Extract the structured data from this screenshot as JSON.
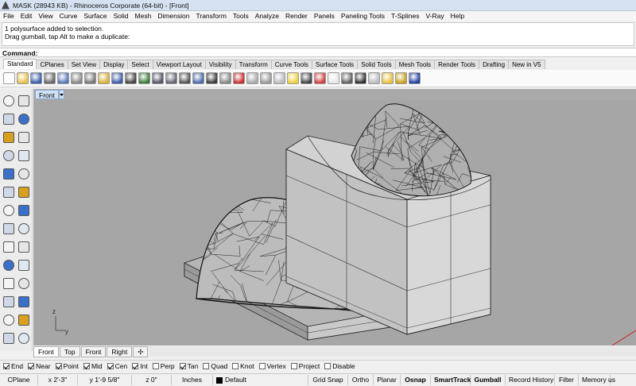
{
  "window": {
    "title": "MASK (28943 KB) - Rhinoceros Corporate (64-bit) - [Front]"
  },
  "menu": [
    "File",
    "Edit",
    "View",
    "Curve",
    "Surface",
    "Solid",
    "Mesh",
    "Dimension",
    "Transform",
    "Tools",
    "Analyze",
    "Render",
    "Panels",
    "Paneling Tools",
    "T-Splines",
    "V-Ray",
    "Help"
  ],
  "history": {
    "line1": "1 polysurface added to selection.",
    "line2": "Drag gumball, tap Alt to make a duplicate:"
  },
  "command": {
    "label": "Command:"
  },
  "toolbar_tabs": [
    "Standard",
    "CPlanes",
    "Set View",
    "Display",
    "Select",
    "Viewport Layout",
    "Visibility",
    "Transform",
    "Curve Tools",
    "Surface Tools",
    "Solid Tools",
    "Mesh Tools",
    "Render Tools",
    "Drafting",
    "New in V5"
  ],
  "toolbar_icons": [
    "new-file-icon",
    "open-folder-icon",
    "save-icon",
    "print-icon",
    "import-icon",
    "cut-icon",
    "copy-icon",
    "paste-icon",
    "undo-icon",
    "pan-hand-icon",
    "rotate-view-icon",
    "zoom-icon",
    "zoom-window-icon",
    "zoom-extents-icon",
    "zoom-selected-icon",
    "set-view-icon",
    "four-viewports-icon",
    "car-icon",
    "light-icon",
    "sphere-shade-icon",
    "target-icon",
    "bulb-icon",
    "lock-icon",
    "material-icon",
    "render-sphere-icon",
    "render-preview-icon",
    "vray-sphere-icon",
    "vray-render-icon",
    "vray-options-icon",
    "gears-icon",
    "help-icon"
  ],
  "left_tools": [
    "select-arrow-icon",
    "point-icon",
    "polyline-icon",
    "curve-points-icon",
    "circle-icon",
    "ellipse-icon",
    "arc-icon",
    "rectangle-icon",
    "polygon-icon",
    "fillet-curve-icon",
    "surface-icon",
    "extrude-icon",
    "box-solid-icon",
    "sphere-solid-icon",
    "cylinder-icon",
    "mesh-icon",
    "boolean-icon",
    "explode-icon",
    "move-icon",
    "rotate-icon",
    "text-icon",
    "dimension-icon",
    "array-icon",
    "group-icon",
    "grid-array-icon",
    "layer-icon",
    "analyze-icon",
    "settings-icon"
  ],
  "viewport": {
    "name": "Front",
    "axis_x": "y",
    "axis_y": "z"
  },
  "view_tabs": [
    "Front",
    "Top",
    "Front",
    "Right"
  ],
  "view_tab_add": "✢",
  "osnaps": [
    {
      "label": "End",
      "checked": true
    },
    {
      "label": "Near",
      "checked": true
    },
    {
      "label": "Point",
      "checked": true
    },
    {
      "label": "Mid",
      "checked": true
    },
    {
      "label": "Cen",
      "checked": true
    },
    {
      "label": "Int",
      "checked": true
    },
    {
      "label": "Perp",
      "checked": false
    },
    {
      "label": "Tan",
      "checked": true
    },
    {
      "label": "Quad",
      "checked": false
    },
    {
      "label": "Knot",
      "checked": false
    },
    {
      "label": "Vertex",
      "checked": false
    },
    {
      "label": "Project",
      "checked": false
    },
    {
      "label": "Disable",
      "checked": false
    }
  ],
  "status": {
    "cplane": "CPlane",
    "x": "x 2'-3\"",
    "y": "y 1'-9 5/8\"",
    "z": "z 0\"",
    "units": "Inches",
    "layer": "Default",
    "toggles": [
      "Grid Snap",
      "Ortho",
      "Planar",
      "Osnap",
      "SmartTrack",
      "Gumball",
      "Record History",
      "Filter",
      "Memory us"
    ],
    "bold_toggles": [
      "Osnap",
      "SmartTrack",
      "Gumball"
    ]
  }
}
